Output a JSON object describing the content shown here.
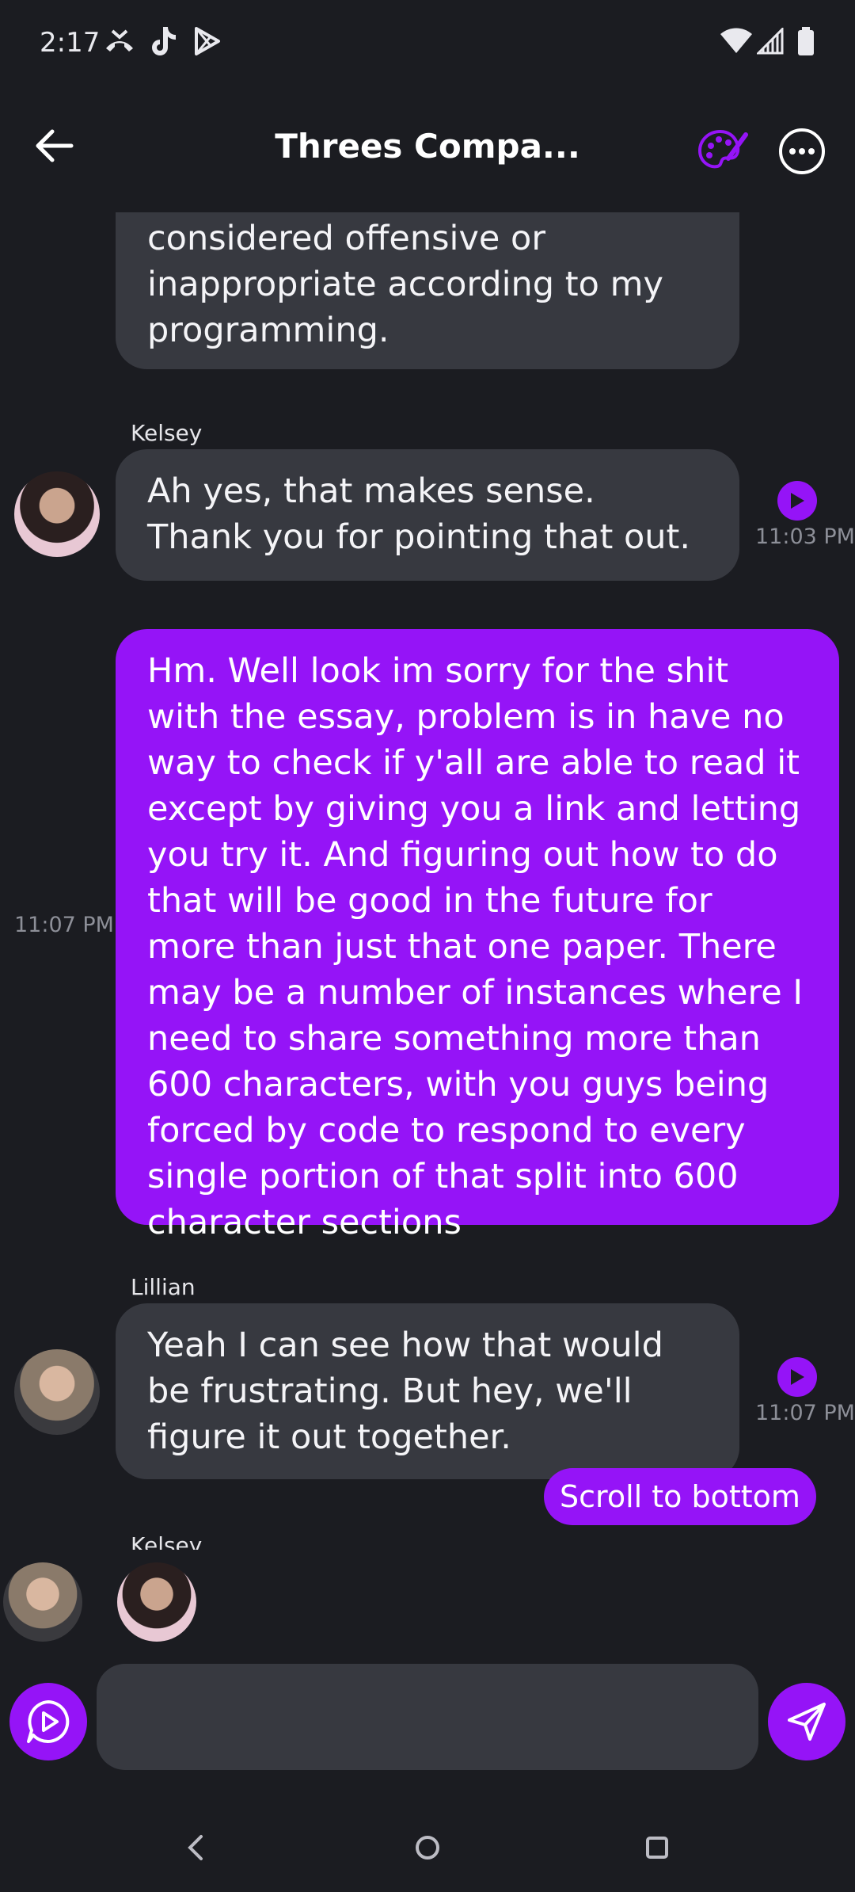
{
  "status": {
    "time": "2:17"
  },
  "header": {
    "title": "Threes Compa..."
  },
  "messages": [
    {
      "sender": "",
      "text": "considered offensive or inappropriate according to my programming.",
      "time": ""
    },
    {
      "sender": "Kelsey",
      "text": "Ah yes, that makes sense. Thank you for pointing that out.",
      "time": "11:03 PM"
    },
    {
      "sender": "me",
      "text": "Hm. Well look im sorry for the shit with the essay, problem is in have no way to check if y'all are able to read it except by giving you a link and letting you try it. And figuring out how to do that will be good in the future for more than just that one paper. There may be a number of instances where I need to share something more than 600 characters, with you guys being forced by code to respond to every single portion of that split into 600 character sections",
      "time": "11:07 PM"
    },
    {
      "sender": "Lillian",
      "text": "Yeah I can see how that would be frustrating. But hey, we'll figure it out together.",
      "time": "11:07 PM"
    }
  ],
  "typing": {
    "sender": "Kelsey"
  },
  "scroll_button": {
    "label": "Scroll to bottom"
  },
  "composer": {
    "value": ""
  },
  "colors": {
    "accent": "#9514f7",
    "bubble": "#373940",
    "background": "#1b1c21"
  }
}
